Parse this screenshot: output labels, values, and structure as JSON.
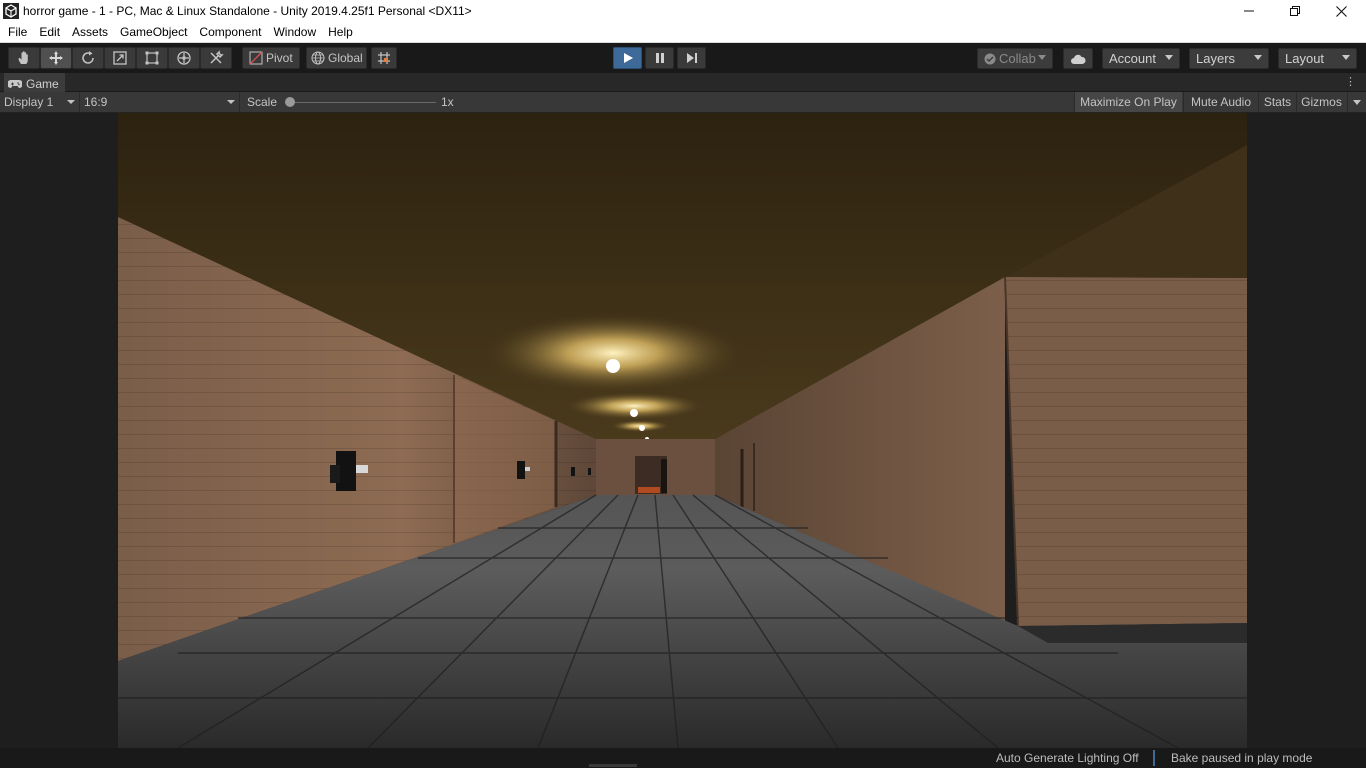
{
  "window": {
    "title": "horror game - 1 - PC, Mac & Linux Standalone - Unity 2019.4.25f1 Personal <DX11>",
    "controls": [
      "minimize",
      "maximize",
      "close"
    ]
  },
  "menubar": {
    "items": [
      "File",
      "Edit",
      "Assets",
      "GameObject",
      "Component",
      "Window",
      "Help"
    ]
  },
  "toolbar": {
    "tools": [
      "hand-tool",
      "move-tool",
      "rotate-tool",
      "scale-tool",
      "rect-tool",
      "transform-tool",
      "custom-tool"
    ],
    "pivot_label": "Pivot",
    "global_label": "Global",
    "collab_label": "Collab",
    "account_label": "Account",
    "layers_label": "Layers",
    "layout_label": "Layout"
  },
  "game_tab": {
    "label": "Game"
  },
  "game_bar": {
    "display_label": "Display 1",
    "aspect_label": "16:9",
    "scale_label": "Scale",
    "scale_value": "1x",
    "scale_level": 0,
    "maximize_on_play_label": "Maximize On Play",
    "mute_audio_label": "Mute Audio",
    "stats_label": "Stats",
    "gizmos_label": "Gizmos"
  },
  "status": {
    "auto_lighting": "Auto Generate Lighting Off",
    "bake_status": "Bake paused in play mode"
  },
  "colors": {
    "play_active": "#3d6a99",
    "toolbar_bg": "#191919",
    "panel_bg": "#383838",
    "wall": "#8a6a52",
    "floor": "#3a3a3a",
    "ceiling_light": "#f5e6a8"
  }
}
